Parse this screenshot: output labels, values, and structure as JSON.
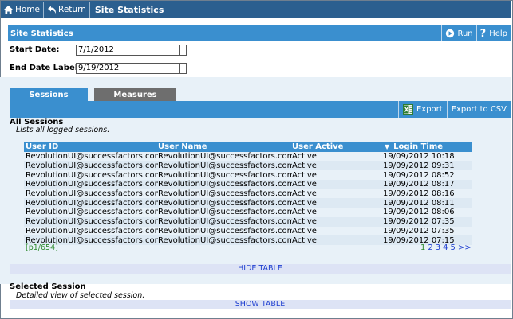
{
  "nav": {
    "home_label": "Home",
    "return_label": "Return",
    "title": "Site Statistics"
  },
  "section": {
    "title": "Site Statistics",
    "run_label": "Run",
    "help_label": "Help"
  },
  "form": {
    "start_date_label": "Start Date:",
    "start_date_value": "7/1/2012",
    "end_date_label": "End Date Label:",
    "end_date_value": "9/19/2012"
  },
  "tabs": [
    {
      "label": "Sessions",
      "active": true
    },
    {
      "label": "Measures",
      "active": false
    }
  ],
  "toolbar": {
    "export_label": "Export",
    "export_csv_label": "Export to CSV"
  },
  "sessions": {
    "title": "All Sessions",
    "subtitle": "Lists all logged sessions.",
    "columns": [
      "User ID",
      "User Name",
      "User Active",
      "Login Time"
    ],
    "sort_indicator": "▼",
    "rows": [
      [
        "RevolutionUI@successfactors.com",
        "RevolutionUI@successfactors.com",
        "Active",
        "19/09/2012 10:18"
      ],
      [
        "RevolutionUI@successfactors.com",
        "RevolutionUI@successfactors.com",
        "Active",
        "19/09/2012 09:31"
      ],
      [
        "RevolutionUI@successfactors.com",
        "RevolutionUI@successfactors.com",
        "Active",
        "19/09/2012 08:52"
      ],
      [
        "RevolutionUI@successfactors.com",
        "RevolutionUI@successfactors.com",
        "Active",
        "19/09/2012 08:17"
      ],
      [
        "RevolutionUI@successfactors.com",
        "RevolutionUI@successfactors.com",
        "Active",
        "19/09/2012 08:16"
      ],
      [
        "RevolutionUI@successfactors.com",
        "RevolutionUI@successfactors.com",
        "Active",
        "19/09/2012 08:11"
      ],
      [
        "RevolutionUI@successfactors.com",
        "RevolutionUI@successfactors.com",
        "Active",
        "19/09/2012 08:06"
      ],
      [
        "RevolutionUI@successfactors.com",
        "RevolutionUI@successfactors.com",
        "Active",
        "19/09/2012 07:35"
      ],
      [
        "RevolutionUI@successfactors.com",
        "RevolutionUI@successfactors.com",
        "Active",
        "19/09/2012 07:35"
      ],
      [
        "RevolutionUI@successfactors.com",
        "RevolutionUI@successfactors.com",
        "Active",
        "19/09/2012 07:15"
      ]
    ],
    "page_info": "[p1/654]",
    "pages": [
      "1",
      "2",
      "3",
      "4",
      "5",
      ">>"
    ],
    "current_page": "1",
    "hide_label": "HIDE TABLE"
  },
  "selected": {
    "title": "Selected Session",
    "subtitle": "Detailed view of selected session.",
    "show_label": "SHOW TABLE"
  },
  "colors": {
    "nav_bg": "#2b5f8f",
    "accent_blue": "#3a8fcf",
    "inactive_tab": "#6e6e6e",
    "link_blue": "#1f3fd0",
    "pager_green": "#2e8b2e"
  },
  "icons": [
    "home-icon",
    "return-icon",
    "run-icon",
    "help-icon",
    "excel-export-icon"
  ]
}
